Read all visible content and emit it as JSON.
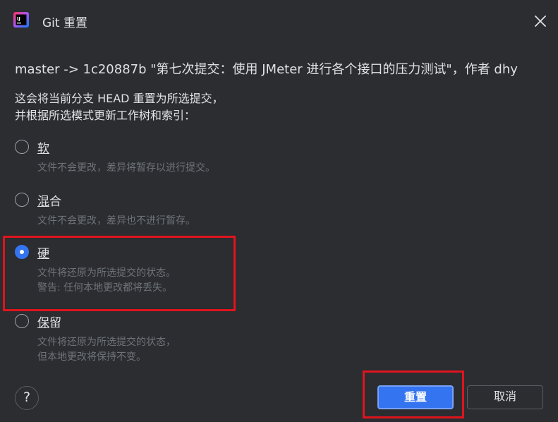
{
  "window": {
    "title": "Git 重置",
    "app_icon": "intellij-idea-icon",
    "close_icon": "close-icon"
  },
  "commit_line": "master -> 1c20887b \"第七次提交：使用 JMeter 进行各个接口的压力测试\"，作者 dhy",
  "description": {
    "line1": "这会将当前分支 HEAD 重置为所选提交，",
    "line2": "并根据所选模式更新工作树和索引："
  },
  "options": [
    {
      "key": "soft",
      "mnemonic": "软",
      "label_rest": "",
      "hint_lines": [
        "文件不会更改，差异将暂存以进行提交。"
      ],
      "checked": false
    },
    {
      "key": "mixed",
      "mnemonic": "混",
      "label_rest": "合",
      "hint_lines": [
        "文件不会更改，差异也不进行暂存。"
      ],
      "checked": false
    },
    {
      "key": "hard",
      "mnemonic": "硬",
      "label_rest": "",
      "hint_lines": [
        "文件将还原为所选提交的状态。",
        "警告: 任何本地更改都将丢失。"
      ],
      "checked": true
    },
    {
      "key": "keep",
      "mnemonic": "保",
      "label_rest": "留",
      "hint_lines": [
        "文件将还原为所选提交的状态，",
        "但本地更改将保持不变。"
      ],
      "checked": false
    }
  ],
  "footer": {
    "help_label": "?",
    "primary_button": "重置",
    "cancel_button": "取消"
  },
  "colors": {
    "background": "#2b2d30",
    "accent": "#3574f0",
    "highlight": "#e0141e",
    "hint_text": "#6f737a"
  }
}
